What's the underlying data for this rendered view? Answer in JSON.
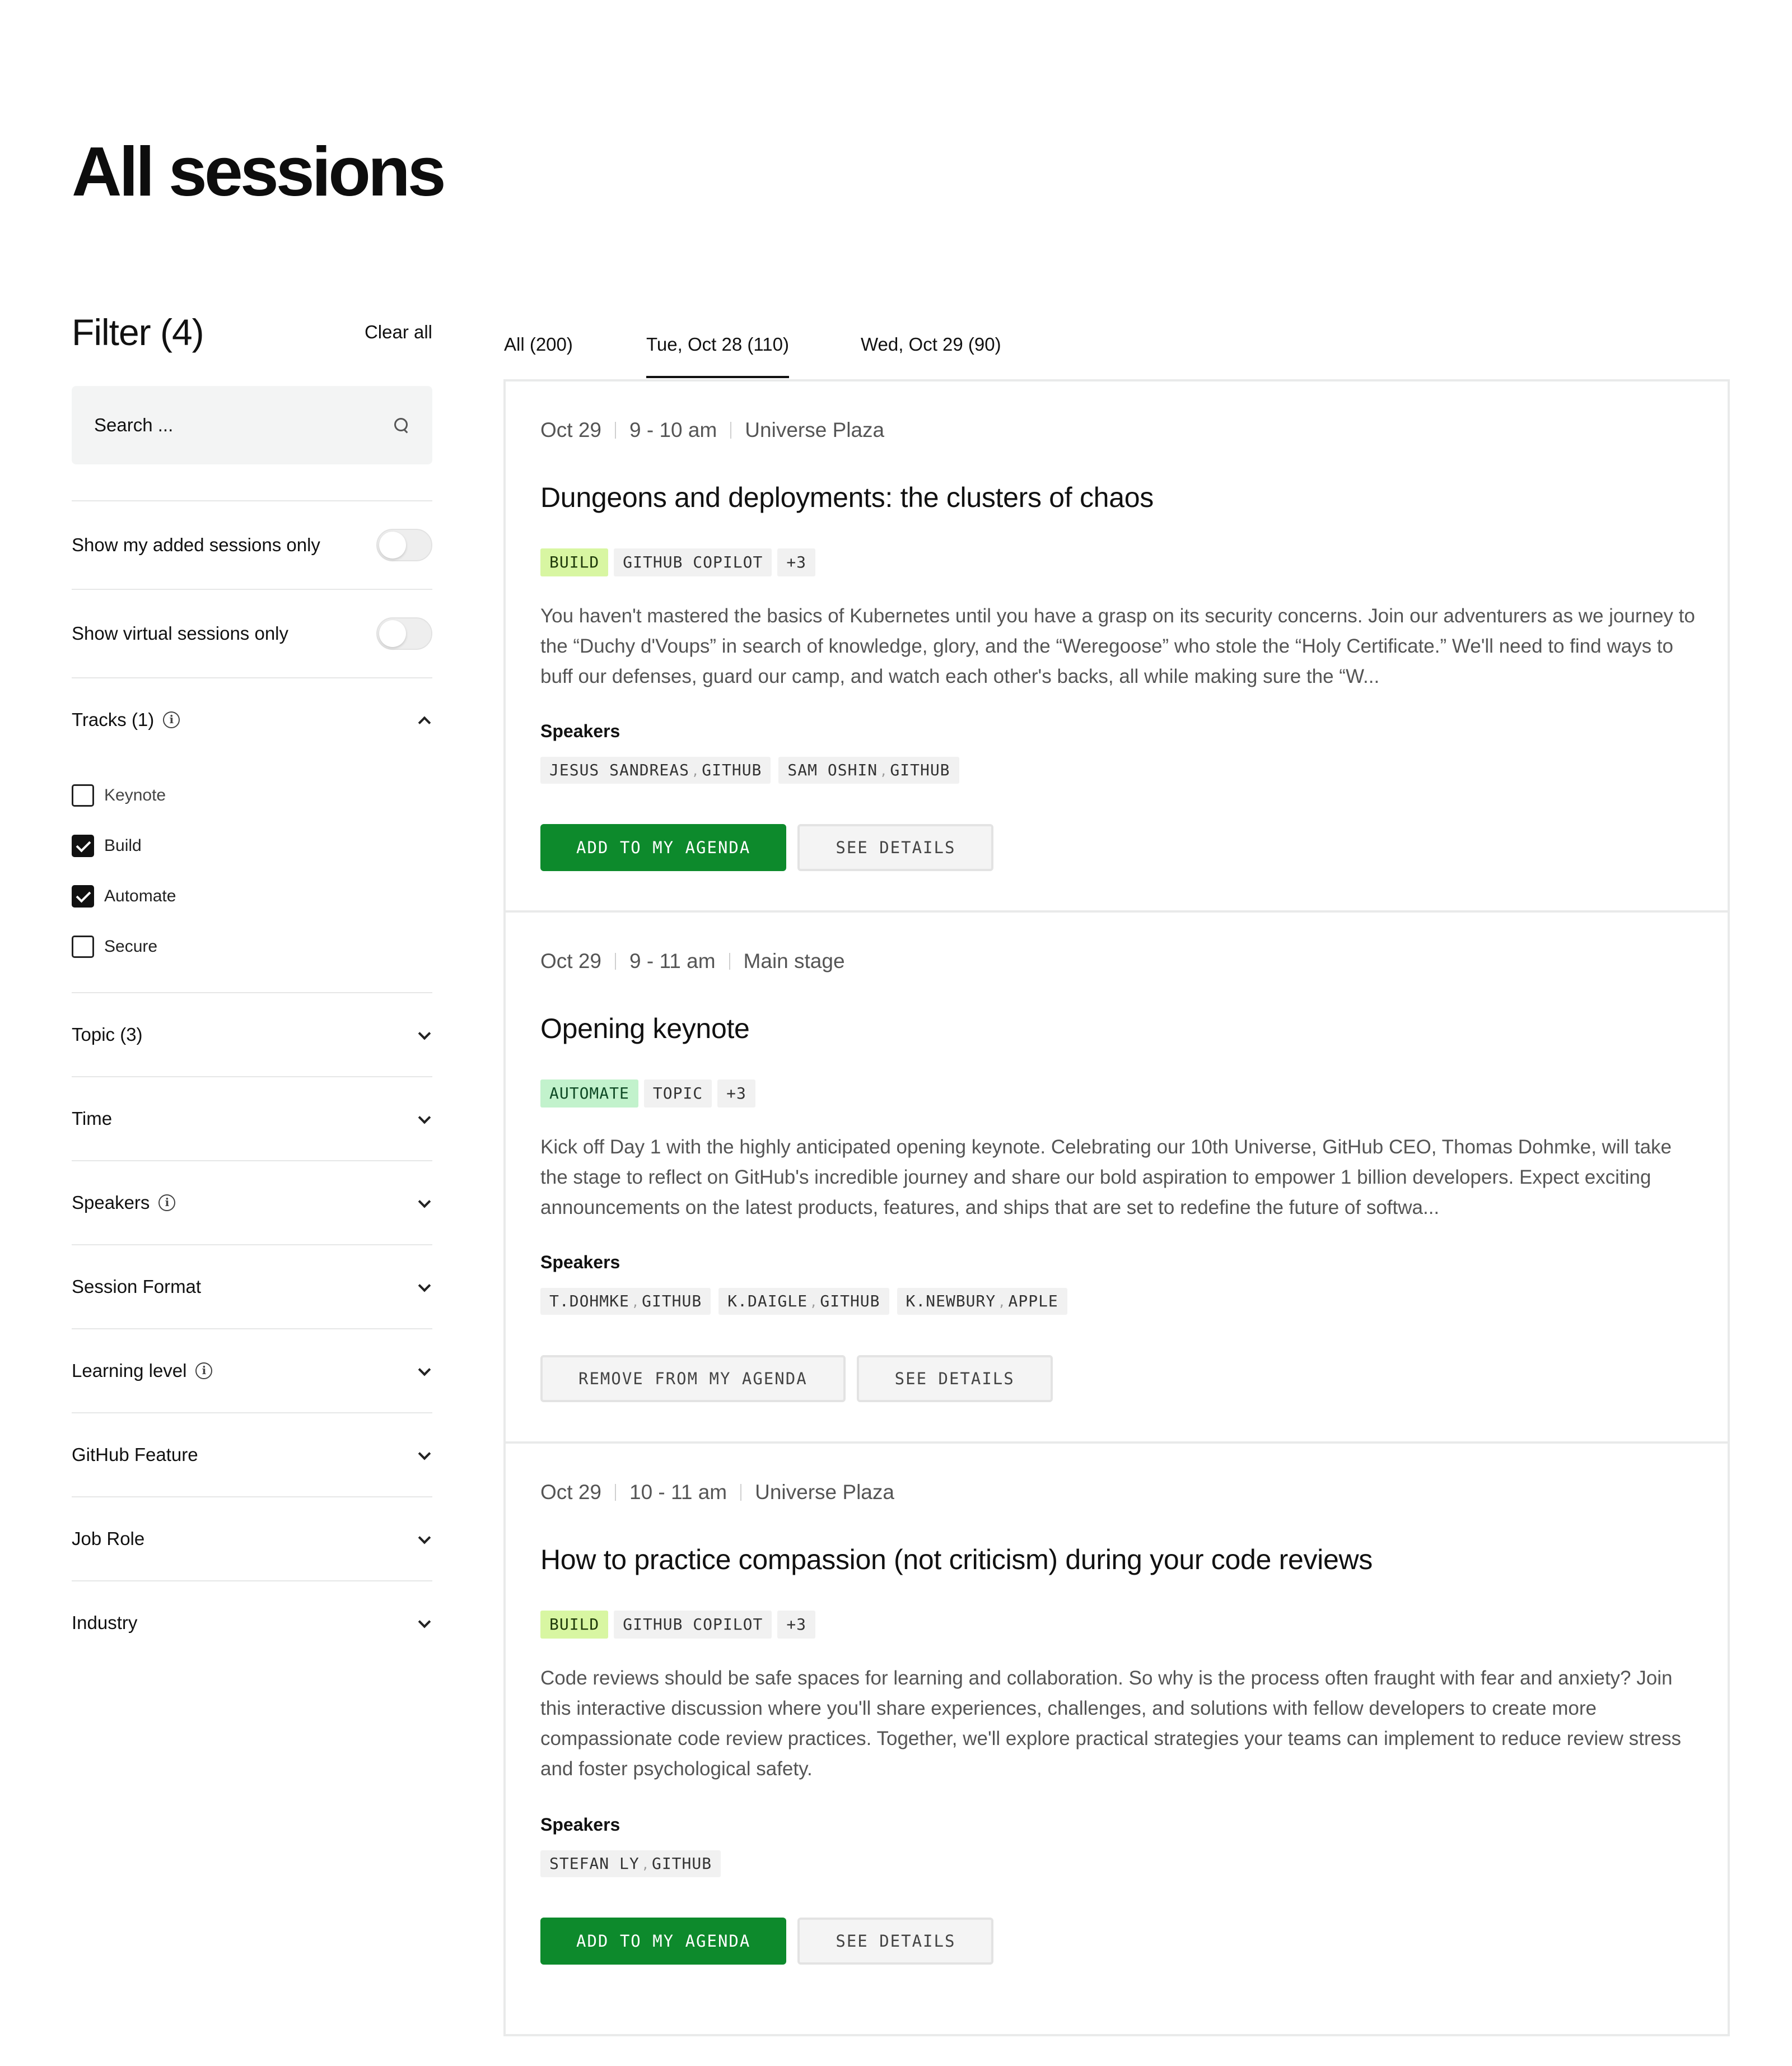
{
  "page": {
    "title": "All sessions"
  },
  "filter": {
    "title": "Filter (4)",
    "clear_all": "Clear all",
    "search_placeholder": "Search ...",
    "toggles": [
      {
        "label": "Show my added sessions only",
        "on": false
      },
      {
        "label": "Show virtual sessions only",
        "on": false
      }
    ],
    "tracks": {
      "label": "Tracks (1)",
      "items": [
        {
          "label": "Keynote",
          "checked": false
        },
        {
          "label": "Build",
          "checked": true
        },
        {
          "label": "Automate",
          "checked": true
        },
        {
          "label": "Secure",
          "checked": false
        }
      ]
    },
    "sections": [
      {
        "label": "Topic (3)",
        "info": false
      },
      {
        "label": "Time",
        "info": false
      },
      {
        "label": "Speakers",
        "info": true
      },
      {
        "label": "Session Format",
        "info": false
      },
      {
        "label": "Learning level",
        "info": true
      },
      {
        "label": "GitHub Feature",
        "info": false
      },
      {
        "label": "Job Role",
        "info": false
      },
      {
        "label": "Industry",
        "info": false
      }
    ]
  },
  "tabs": [
    {
      "label": "All (200)",
      "active": false
    },
    {
      "label": "Tue, Oct 28 (110)",
      "active": true
    },
    {
      "label": "Wed, Oct 29 (90)",
      "active": false
    }
  ],
  "sessions": [
    {
      "date": "Oct 29",
      "time": "9 - 10 am",
      "location": "Universe Plaza",
      "title": "Dungeons and deployments: the clusters of chaos",
      "tags": [
        "BUILD",
        "GITHUB COPILOT",
        "+3"
      ],
      "description": "You haven't mastered the basics of Kubernetes until you have a grasp on its security concerns. Join our adventurers as we journey to the “Duchy d'Voups” in search of knowledge, glory, and the “Weregoose” who stole the “Holy Certificate.” We'll need to find ways to buff our defenses, guard our camp, and watch each other's backs, all while making sure the “W...",
      "speakers_label": "Speakers",
      "speakers": [
        {
          "name": "JESUS SANDREAS",
          "company": "GITHUB"
        },
        {
          "name": "SAM OSHIN",
          "company": "GITHUB"
        }
      ],
      "primary_action": "ADD TO MY AGENDA",
      "secondary_action": "SEE DETAILS",
      "in_agenda": false
    },
    {
      "date": "Oct 29",
      "time": "9 - 11 am",
      "location": "Main stage",
      "title": "Opening keynote",
      "tags": [
        "AUTOMATE",
        "TOPIC",
        "+3"
      ],
      "description": "Kick off Day 1 with the highly anticipated opening keynote. Celebrating our 10th Universe, GitHub CEO, Thomas Dohmke, will take the stage to reflect on GitHub's incredible journey and share our bold aspiration to empower 1 billion developers. Expect exciting announcements on the latest products, features, and ships that are set to redefine the future of softwa...",
      "speakers_label": "Speakers",
      "speakers": [
        {
          "name": "T.DOHMKE",
          "company": "GITHUB"
        },
        {
          "name": "K.DAIGLE",
          "company": "GITHUB"
        },
        {
          "name": "K.NEWBURY",
          "company": "APPLE"
        }
      ],
      "primary_action": "REMOVE FROM MY AGENDA",
      "secondary_action": "SEE DETAILS",
      "in_agenda": true
    },
    {
      "date": "Oct 29",
      "time": "10 - 11 am",
      "location": "Universe Plaza",
      "title": "How to practice compassion (not criticism) during your code reviews",
      "tags": [
        "BUILD",
        "GITHUB COPILOT",
        "+3"
      ],
      "description": "Code reviews should be safe spaces for learning and collaboration. So why is the process often fraught with fear and anxiety? Join this interactive discussion where you'll share experiences, challenges, and solutions with fellow developers to create more compassionate code review practices. Together, we'll explore practical strategies your teams can implement to reduce review stress and foster psychological safety.",
      "speakers_label": "Speakers",
      "speakers": [
        {
          "name": "STEFAN LY",
          "company": "GITHUB"
        }
      ],
      "primary_action": "ADD TO MY AGENDA",
      "secondary_action": "SEE DETAILS",
      "in_agenda": false
    }
  ],
  "colors": {
    "accent_green": "#0d8a2c",
    "tag_build": "#d8f6a2",
    "tag_automate": "#c2f2cc",
    "tag_default": "#f1f1f1"
  }
}
